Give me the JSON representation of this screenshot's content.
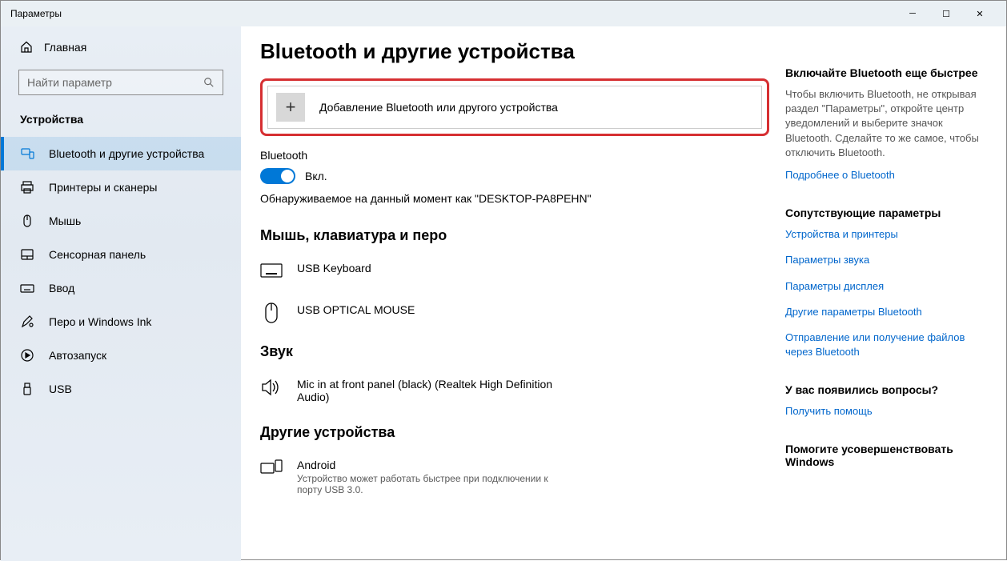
{
  "titlebar": {
    "title": "Параметры"
  },
  "sidebar": {
    "home": "Главная",
    "searchPlaceholder": "Найти параметр",
    "section": "Устройства",
    "items": [
      {
        "label": "Bluetooth и другие устройства",
        "active": true
      },
      {
        "label": "Принтеры и сканеры"
      },
      {
        "label": "Мышь"
      },
      {
        "label": "Сенсорная панель"
      },
      {
        "label": "Ввод"
      },
      {
        "label": "Перо и Windows Ink"
      },
      {
        "label": "Автозапуск"
      },
      {
        "label": "USB"
      }
    ]
  },
  "page": {
    "title": "Bluetooth и другие устройства",
    "addDevice": "Добавление Bluetooth или другого устройства",
    "bluetoothLabel": "Bluetooth",
    "toggleState": "Вкл.",
    "discoverable": "Обнаруживаемое на данный момент как \"DESKTOP-PA8PEHN\"",
    "sections": {
      "mouseKeyboard": {
        "title": "Мышь, клавиатура и перо",
        "items": [
          {
            "name": "USB Keyboard"
          },
          {
            "name": "USB OPTICAL MOUSE"
          }
        ]
      },
      "sound": {
        "title": "Звук",
        "items": [
          {
            "name": "Mic in at front panel (black) (Realtek High Definition Audio)"
          }
        ]
      },
      "other": {
        "title": "Другие устройства",
        "items": [
          {
            "name": "Android",
            "sub": "Устройство может работать быстрее при подключении к порту USB 3.0."
          }
        ]
      }
    }
  },
  "right": {
    "fastBT": {
      "title": "Включайте Bluetooth еще быстрее",
      "body": "Чтобы включить Bluetooth, не открывая раздел \"Параметры\", откройте центр уведомлений и выберите значок Bluetooth. Сделайте то же самое, чтобы отключить Bluetooth.",
      "link": "Подробнее о Bluetooth"
    },
    "related": {
      "title": "Сопутствующие параметры",
      "links": [
        "Устройства и принтеры",
        "Параметры звука",
        "Параметры дисплея",
        "Другие параметры Bluetooth",
        "Отправление или получение файлов через Bluetooth"
      ]
    },
    "questions": {
      "title": "У вас появились вопросы?",
      "link": "Получить помощь"
    },
    "improve": {
      "title": "Помогите усовершенствовать Windows"
    }
  }
}
